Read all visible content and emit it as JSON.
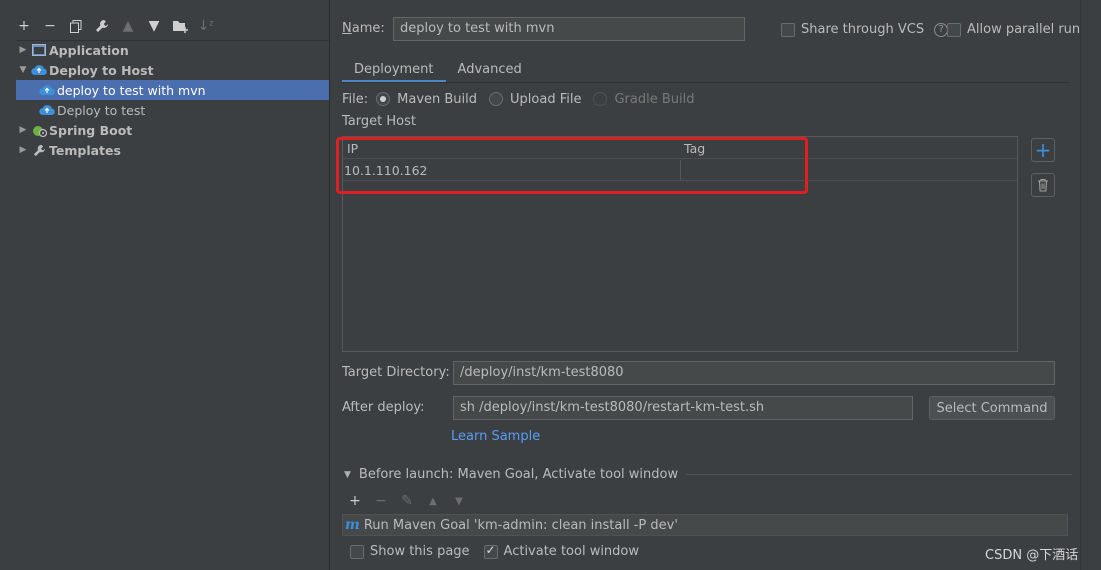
{
  "left_toolbar": {
    "buttons": [
      {
        "name": "add-icon",
        "glyph": "+"
      },
      {
        "name": "remove-icon",
        "glyph": "−"
      },
      {
        "name": "copy-icon",
        "glyph": "⧉"
      },
      {
        "name": "wrench-icon",
        "glyph": "🔧"
      },
      {
        "name": "move-up-icon",
        "glyph": "▲"
      },
      {
        "name": "move-down-icon",
        "glyph": "▼"
      },
      {
        "name": "folder-add-icon",
        "glyph": "▣"
      },
      {
        "name": "sort-icon",
        "glyph": "↓"
      }
    ]
  },
  "tree": {
    "application": "Application",
    "deploy_to_host": "Deploy to Host",
    "child_selected": "deploy to test with mvn",
    "child_2": "Deploy to test",
    "spring_boot": "Spring Boot",
    "templates": "Templates"
  },
  "form": {
    "name_label": "Name:",
    "name_value": "deploy to test with mvn",
    "share_vcs": "Share through VCS",
    "allow_parallel": "Allow parallel run",
    "tabs": [
      "Deployment",
      "Advanced"
    ],
    "file_label": "File:",
    "file_options": [
      {
        "label": "Maven Build",
        "selected": true,
        "disabled": false
      },
      {
        "label": "Upload File",
        "selected": false,
        "disabled": false
      },
      {
        "label": "Gradle Build",
        "selected": false,
        "disabled": true
      }
    ],
    "target_host_label": "Target Host",
    "host_table": {
      "columns": [
        "IP",
        "Tag"
      ],
      "rows": [
        [
          "10.1.110.162",
          ""
        ]
      ]
    },
    "target_dir_label": "Target Directory:",
    "target_dir_value": "/deploy/inst/km-test8080",
    "after_deploy_label": "After deploy:",
    "after_deploy_value": "sh /deploy/inst/km-test8080/restart-km-test.sh",
    "select_command": "Select Command",
    "learn_sample": "Learn Sample",
    "before_launch": "Before launch: Maven Goal, Activate tool window",
    "task": "Run Maven Goal 'km-admin: clean install -P dev'",
    "show_page": "Show this page",
    "activate_window": "Activate tool window"
  },
  "watermark": "CSDN @下酒话",
  "colors": {
    "background": "#3c3f41",
    "selection": "#4b6eaf",
    "accent": "#4a88c7",
    "link": "#589df6",
    "highlight": "#e02020"
  }
}
